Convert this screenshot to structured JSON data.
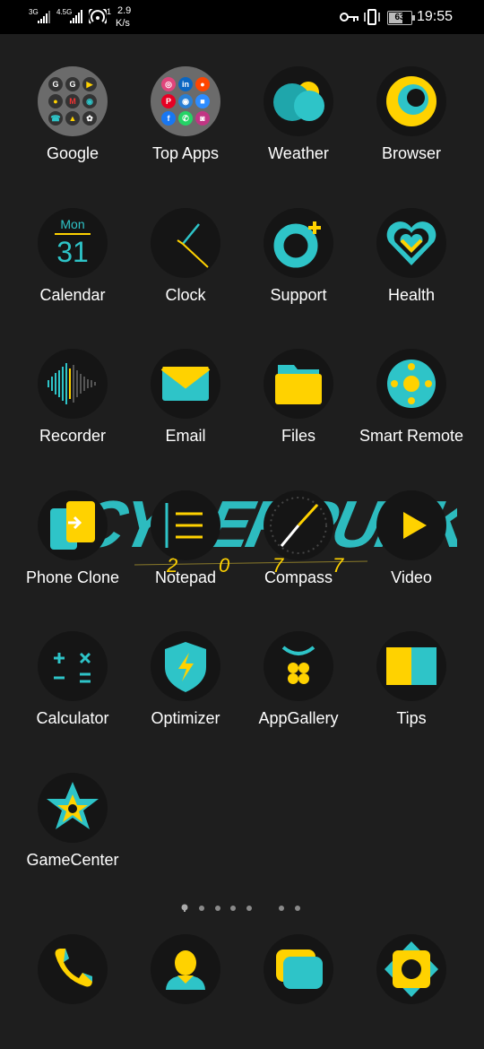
{
  "status_bar": {
    "network1": "3G",
    "network2": "4.5G",
    "hotspot_count": "1",
    "speed_value": "2.9",
    "speed_unit": "K/s",
    "battery": "63",
    "time": "19:55",
    "icons": [
      "key-icon",
      "vibrate-icon",
      "battery-icon"
    ]
  },
  "wallpaper_text": {
    "logo": "CYBERPUNK",
    "year_digits": [
      "2",
      "0",
      "7",
      "7"
    ]
  },
  "apps": [
    {
      "label": "Google"
    },
    {
      "label": "Top Apps"
    },
    {
      "label": "Weather"
    },
    {
      "label": "Browser"
    },
    {
      "label": "Calendar",
      "icon_day": "Mon",
      "icon_date": "31"
    },
    {
      "label": "Clock"
    },
    {
      "label": "Support"
    },
    {
      "label": "Health"
    },
    {
      "label": "Recorder"
    },
    {
      "label": "Email"
    },
    {
      "label": "Files"
    },
    {
      "label": "Smart Remote"
    },
    {
      "label": "Phone Clone"
    },
    {
      "label": "Notepad"
    },
    {
      "label": "Compass"
    },
    {
      "label": "Video"
    },
    {
      "label": "Calculator"
    },
    {
      "label": "Optimizer"
    },
    {
      "label": "AppGallery"
    },
    {
      "label": "Tips"
    },
    {
      "label": "GameCenter"
    }
  ],
  "google_folder": {
    "minis": [
      "G",
      "G",
      "▶",
      "●",
      "M",
      "◉",
      "☎",
      "▲",
      "✿"
    ]
  },
  "topapps_folder": {
    "minis": [
      "◎",
      "in",
      "●",
      "P",
      "◉",
      "■",
      "f",
      "✆",
      "◙"
    ]
  },
  "page_indicator": {
    "pages": 8,
    "current": 0
  },
  "dock": [
    {
      "name": "phone"
    },
    {
      "name": "contacts"
    },
    {
      "name": "messages"
    },
    {
      "name": "camera"
    }
  ],
  "colors": {
    "accent_yellow": "#ffd200",
    "accent_cyan": "#2ec4c8",
    "icon_bg": "#151515",
    "background": "#1e1e1e"
  }
}
